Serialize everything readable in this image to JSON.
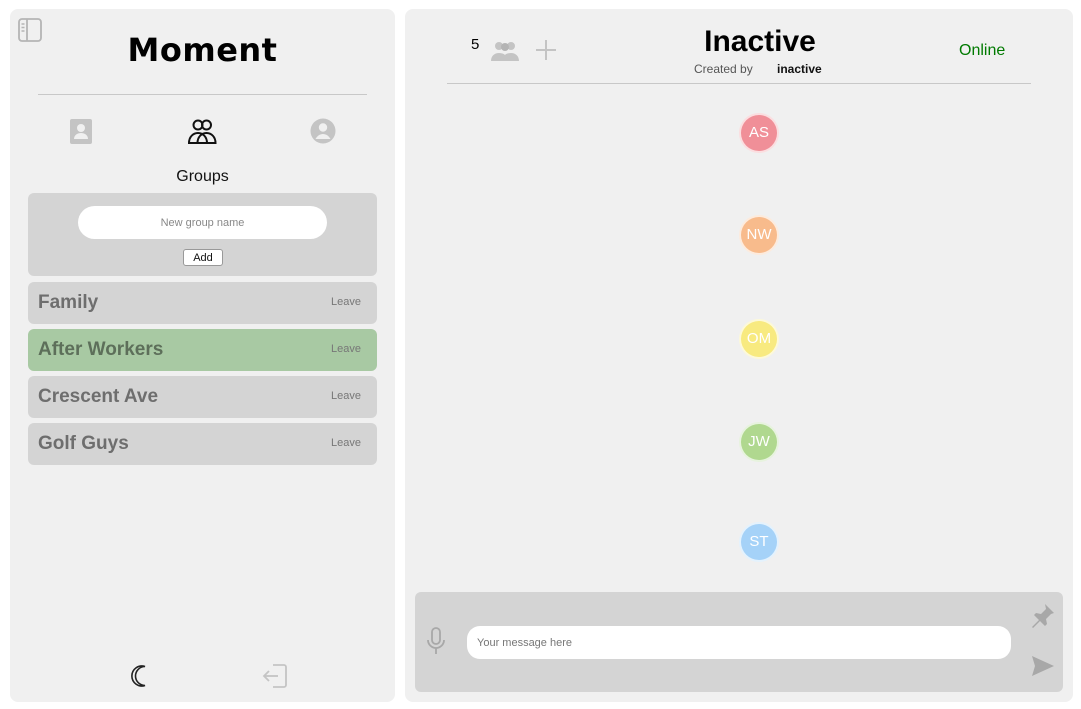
{
  "app": {
    "title": "Moment"
  },
  "sidebar": {
    "toggle_icon": "sidebar-toggle-icon",
    "nav": [
      {
        "id": "contacts",
        "icon": "contact-book-icon"
      },
      {
        "id": "groups",
        "icon": "groups-icon",
        "active": true
      },
      {
        "id": "profile",
        "icon": "user-circle-icon"
      }
    ],
    "section_title": "Groups",
    "new_group": {
      "placeholder": "New group name",
      "value": "",
      "add_label": "Add"
    },
    "groups": [
      {
        "name": "Family",
        "leave_label": "Leave",
        "active": false
      },
      {
        "name": "After Workers",
        "leave_label": "Leave",
        "active": true
      },
      {
        "name": "Crescent Ave",
        "leave_label": "Leave",
        "active": false
      },
      {
        "name": "Golf Guys",
        "leave_label": "Leave",
        "active": false
      }
    ],
    "footer": {
      "theme_icon": "moon-icon",
      "logout_icon": "logout-icon"
    }
  },
  "chat": {
    "member_count": "5",
    "members_icon": "members-icon",
    "add_member_icon": "plus-icon",
    "title": "Inactive",
    "created_by_label": "Created by",
    "creator": "inactive",
    "status": "Online",
    "status_color": "#007a00",
    "members": [
      {
        "initials": "AS",
        "color": "#f08f98"
      },
      {
        "initials": "NW",
        "color": "#f8bb8c"
      },
      {
        "initials": "OM",
        "color": "#f8ea80"
      },
      {
        "initials": "JW",
        "color": "#b0d88f"
      },
      {
        "initials": "ST",
        "color": "#a5d2f8"
      }
    ],
    "composer": {
      "placeholder": "Your message here",
      "value": "",
      "mic_icon": "microphone-icon",
      "pin_icon": "pin-icon",
      "send_icon": "send-icon"
    }
  },
  "colors": {
    "panel_bg": "#f0f0f0",
    "card_bg": "#d4d4d4",
    "active_group_bg": "#a8c9a3"
  }
}
